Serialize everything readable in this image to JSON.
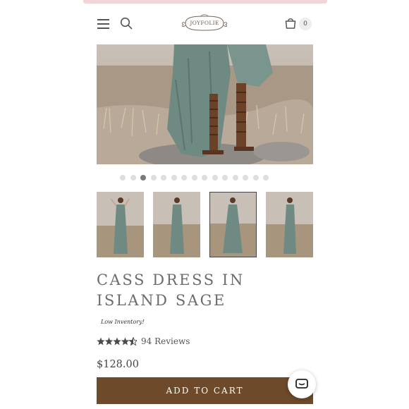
{
  "header": {
    "logo_text": "JOYFOLIE",
    "cart_count": "0",
    "icons": [
      "menu-icon",
      "search-icon",
      "shopping-bag-icon"
    ]
  },
  "gallery": {
    "image_count": 15,
    "active_index": 2,
    "selected_thumbnail": 2,
    "thumbnail_count": 4
  },
  "product": {
    "title": "CASS DRESS IN ISLAND SAGE",
    "inventory_note": "Low Inventory!",
    "rating": 4.5,
    "reviews_label": "94 Reviews",
    "price": "$128.00"
  },
  "actions": {
    "add_to_cart_label": "ADD TO CART"
  },
  "colors": {
    "button_brown": "#6c4a2a",
    "top_strip_pink": "#f1d4d8",
    "dress_sage": "#6e8a82"
  }
}
